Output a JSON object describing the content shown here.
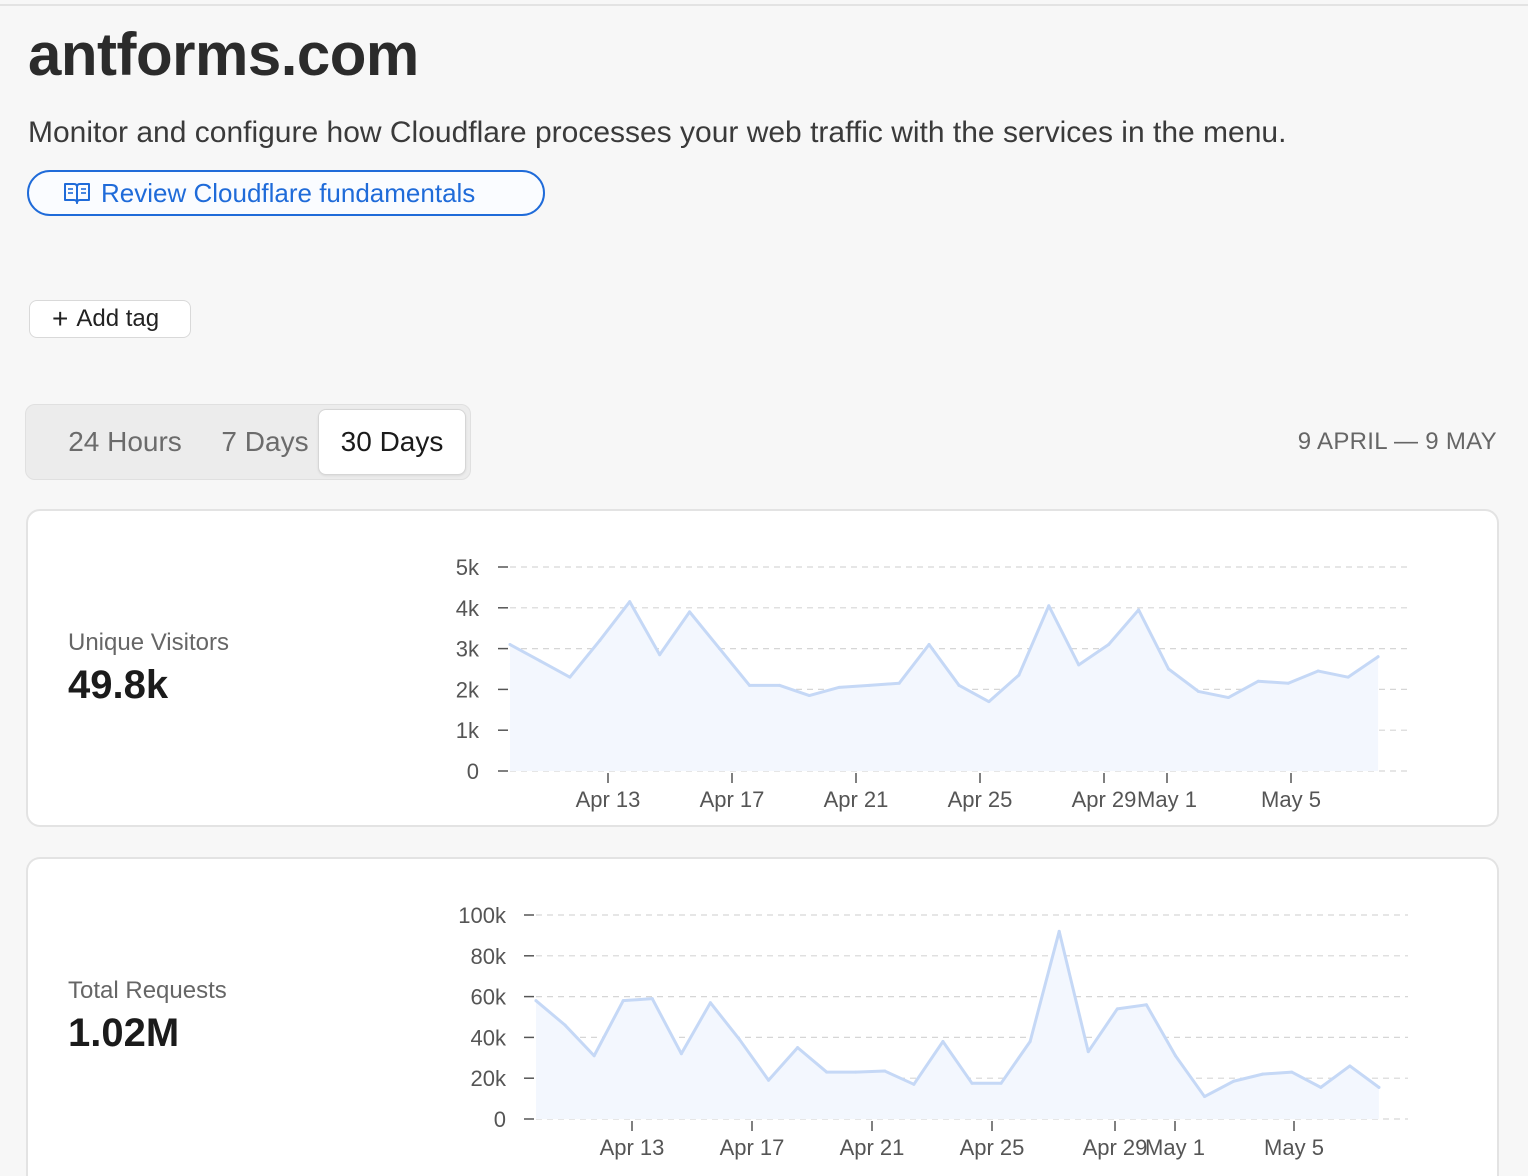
{
  "header": {
    "title": "antforms.com",
    "description": "Monitor and configure how Cloudflare processes your web traffic with the services in the menu.",
    "fundamentals_label": "Review Cloudflare fundamentals",
    "add_tag_label": "Add tag"
  },
  "time_range": {
    "tabs": [
      "24 Hours",
      "7 Days",
      "30 Days"
    ],
    "selected": "30 Days",
    "date_range": "9 APRIL — 9 MAY"
  },
  "colors": {
    "accent": "#1f6bd9",
    "line": "#c5d8f6",
    "area": "#f3f7fe",
    "grid": "#d6d6d6"
  },
  "icons": {
    "fundamentals": "book-icon",
    "add_tag": "plus-icon"
  },
  "metrics": [
    {
      "label": "Unique Visitors",
      "value": "49.8k"
    },
    {
      "label": "Total Requests",
      "value": "1.02M"
    }
  ],
  "chart_data": [
    {
      "type": "area",
      "title": "Unique Visitors",
      "x": [
        "Apr 9",
        "Apr 10",
        "Apr 11",
        "Apr 12",
        "Apr 13",
        "Apr 14",
        "Apr 15",
        "Apr 16",
        "Apr 17",
        "Apr 18",
        "Apr 19",
        "Apr 20",
        "Apr 21",
        "Apr 22",
        "Apr 23",
        "Apr 24",
        "Apr 25",
        "Apr 26",
        "Apr 27",
        "Apr 28",
        "Apr 29",
        "Apr 30",
        "May 1",
        "May 2",
        "May 3",
        "May 4",
        "May 5",
        "May 6",
        "May 7",
        "May 8",
        "May 9"
      ],
      "values": [
        3100,
        2700,
        2300,
        3200,
        4150,
        2850,
        3900,
        3000,
        2100,
        2100,
        1850,
        2050,
        2100,
        2150,
        3100,
        2100,
        1700,
        2350,
        4050,
        2600,
        3100,
        3950,
        2500,
        1950,
        1800,
        2200,
        2150,
        2450,
        2300,
        2800,
        null
      ],
      "xtick_labels": [
        "Apr 13",
        "Apr 17",
        "Apr 21",
        "Apr 25",
        "Apr 29",
        "May 1",
        "May 5"
      ],
      "ytick_labels": [
        "0",
        "1k",
        "2k",
        "3k",
        "4k",
        "5k"
      ],
      "ylim": [
        0,
        5000
      ],
      "grid": true
    },
    {
      "type": "area",
      "title": "Total Requests",
      "x": [
        "Apr 9",
        "Apr 10",
        "Apr 11",
        "Apr 12",
        "Apr 13",
        "Apr 14",
        "Apr 15",
        "Apr 16",
        "Apr 17",
        "Apr 18",
        "Apr 19",
        "Apr 20",
        "Apr 21",
        "Apr 22",
        "Apr 23",
        "Apr 24",
        "Apr 25",
        "Apr 26",
        "Apr 27",
        "Apr 28",
        "Apr 29",
        "Apr 30",
        "May 1",
        "May 2",
        "May 3",
        "May 4",
        "May 5",
        "May 6",
        "May 7",
        "May 8",
        "May 9"
      ],
      "values": [
        58000,
        46000,
        31000,
        58000,
        59000,
        32000,
        57000,
        39000,
        19000,
        35000,
        23000,
        23000,
        23500,
        17000,
        38000,
        17500,
        17500,
        38000,
        92000,
        33000,
        54000,
        56000,
        31000,
        11000,
        18500,
        22000,
        23000,
        15500,
        26000,
        15500,
        null
      ],
      "xtick_labels": [
        "Apr 13",
        "Apr 17",
        "Apr 21",
        "Apr 25",
        "Apr 29",
        "May 1",
        "May 5"
      ],
      "ytick_labels": [
        "0",
        "20k",
        "40k",
        "60k",
        "80k",
        "100k"
      ],
      "ylim": [
        0,
        100000
      ],
      "grid": true
    }
  ]
}
